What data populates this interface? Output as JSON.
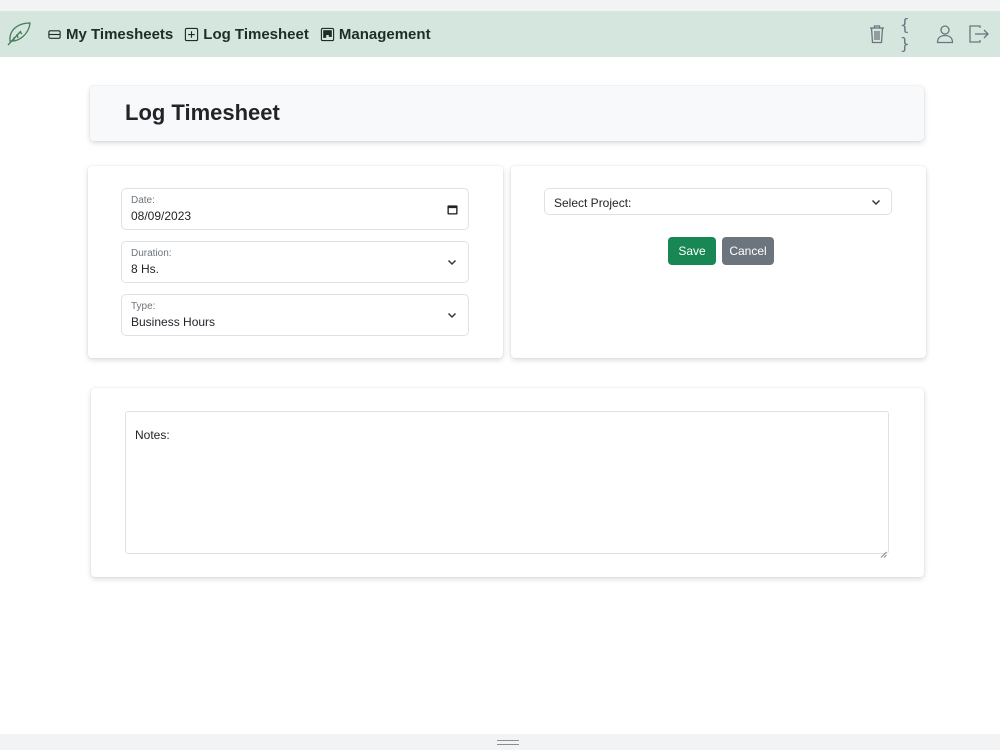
{
  "navbar": {
    "logo_icon": "leaf-icon",
    "links": [
      {
        "label": "My Timesheets",
        "icon": "card-list-icon"
      },
      {
        "label": "Log Timesheet",
        "icon": "plus-square-icon"
      },
      {
        "label": "Management",
        "icon": "kanban-icon"
      }
    ],
    "tools": {
      "trash_icon": "trash-icon",
      "braces_text": "{ }",
      "user_icon": "person-icon",
      "logout_icon": "box-arrow-right-icon"
    },
    "colors": {
      "background": "#d4e6dd",
      "text": "#1f2d26"
    }
  },
  "page": {
    "title": "Log Timesheet"
  },
  "form": {
    "date": {
      "label": "Date:",
      "value": "08/09/2023",
      "icon": "calendar-icon"
    },
    "duration": {
      "label": "Duration:",
      "value": "8 Hs.",
      "icon": "chevron-down-icon"
    },
    "type": {
      "label": "Type:",
      "value": "Business Hours",
      "icon": "chevron-down-icon"
    },
    "project": {
      "value": "Select Project:",
      "icon": "chevron-down-icon"
    },
    "save_label": "Save",
    "cancel_label": "Cancel",
    "notes_label": "Notes:",
    "colors": {
      "save": "#198754",
      "cancel": "#6c757d"
    }
  }
}
